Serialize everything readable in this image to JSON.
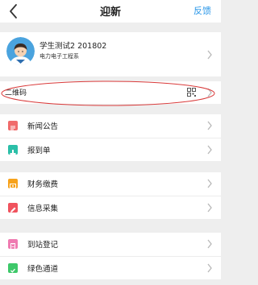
{
  "navbar": {
    "title": "迎新",
    "action_label": "反馈"
  },
  "profile": {
    "name_line": "学生测试2  201802",
    "department": "电力电子工程系"
  },
  "qr": {
    "label": "二维码"
  },
  "menu": {
    "group1": [
      {
        "label": "新闻公告",
        "icon": "news-icon",
        "color": "#f06b6b"
      },
      {
        "label": "报到单",
        "icon": "checkin-form-icon",
        "color": "#2bbfa8"
      }
    ],
    "group2": [
      {
        "label": "财务缴费",
        "icon": "payment-icon",
        "color": "#f7a21b"
      },
      {
        "label": "信息采集",
        "icon": "edit-icon",
        "color": "#f0535e"
      }
    ],
    "group3": [
      {
        "label": "到站登记",
        "icon": "clipboard-icon",
        "color": "#ef7bb1"
      },
      {
        "label": "绿色通道",
        "icon": "green-channel-icon",
        "color": "#3ec86a"
      }
    ]
  }
}
